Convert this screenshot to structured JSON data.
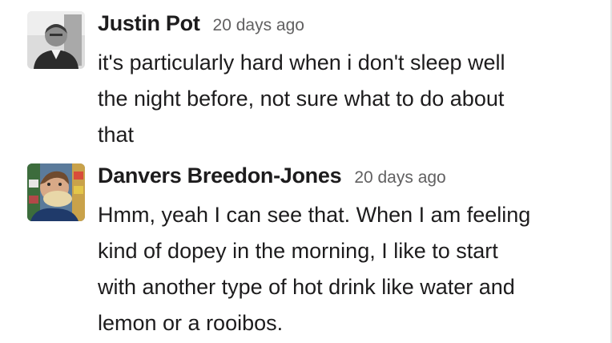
{
  "messages": [
    {
      "author": "Justin Pot",
      "timestamp": "20 days ago",
      "text": "it's particularly hard when i don't sleep well\nthe night before, not sure what to do about\nthat",
      "avatar_icon": "user-photo-grayscale"
    },
    {
      "author": "Danvers Breedon-Jones",
      "timestamp": "20 days ago",
      "text": "Hmm, yeah I can see that. When I am feeling\nkind of dopey in the morning, I like to start\nwith another type of hot drink like water and\nlemon or a rooibos.",
      "avatar_icon": "user-photo-color"
    }
  ],
  "colors": {
    "name": "#1d1c1d",
    "timestamp": "#616061",
    "body_text": "#1d1c1d",
    "divider": "#e4e4e4"
  }
}
